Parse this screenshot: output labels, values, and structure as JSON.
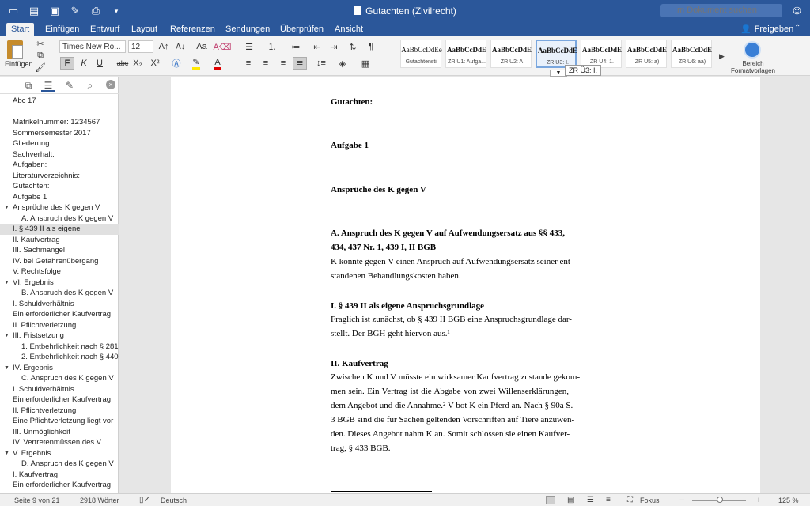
{
  "window": {
    "title": "Gutachten (Zivilrecht)",
    "search_placeholder": "Im Dokument suchen"
  },
  "tabs": [
    {
      "label": "Start"
    },
    {
      "label": "Einfügen"
    },
    {
      "label": "Entwurf"
    },
    {
      "label": "Layout"
    },
    {
      "label": "Referenzen"
    },
    {
      "label": "Sendungen"
    },
    {
      "label": "Überprüfen"
    },
    {
      "label": "Ansicht"
    }
  ],
  "share_label": "Freigeben",
  "ribbon": {
    "paste_label": "Einfügen",
    "font_name": "Times New Ro...",
    "font_size": "12",
    "bold": "F",
    "italic": "K",
    "underline": "U",
    "strike": "abc",
    "sub": "X₂",
    "sup": "X²",
    "styles_label": "Bereich Formatvorlagen",
    "tooltip": "ZR Ü3: I."
  },
  "styles": [
    {
      "sample": "AaBbCcDdEe",
      "name": "Gutachtenstil",
      "bold": false
    },
    {
      "sample": "AaBbCcDdE",
      "name": "ZR Ü1: Aufga...",
      "bold": true
    },
    {
      "sample": "AaBbCcDdE",
      "name": "ZR Ü2: A",
      "bold": true
    },
    {
      "sample": "AaBbCcDdE",
      "name": "ZR Ü3: I.",
      "bold": true
    },
    {
      "sample": "AaBbCcDdE",
      "name": "ZR Ü4: 1.",
      "bold": true
    },
    {
      "sample": "AaBbCcDdE",
      "name": "ZR Ü5: a)",
      "bold": true
    },
    {
      "sample": "AaBbCcDdE",
      "name": "ZR Ü6: aa)",
      "bold": true
    }
  ],
  "outline": [
    {
      "text": "Abc 17",
      "indent": 0
    },
    {
      "text": "",
      "indent": 0
    },
    {
      "text": "Matrikelnummer: 1234567",
      "indent": 0
    },
    {
      "text": "Sommersemester 2017",
      "indent": 0
    },
    {
      "text": "Gliederung:",
      "indent": 0
    },
    {
      "text": "Sachverhalt:",
      "indent": 0
    },
    {
      "text": "Aufgaben:",
      "indent": 0
    },
    {
      "text": "Literaturverzeichnis:",
      "indent": 0
    },
    {
      "text": "Gutachten:",
      "indent": 0
    },
    {
      "text": "Aufgabe 1",
      "indent": 0
    },
    {
      "text": "Ansprüche des K gegen V",
      "indent": 0,
      "tri": true
    },
    {
      "text": "A. Anspruch des K gegen V",
      "indent": 1
    },
    {
      "text": "I. § 439 II als eigene",
      "indent": 0,
      "selected": true
    },
    {
      "text": "II. Kaufvertrag",
      "indent": 0
    },
    {
      "text": "III. Sachmangel",
      "indent": 0
    },
    {
      "text": "IV. bei Gefahrenübergang",
      "indent": 0
    },
    {
      "text": "V. Rechtsfolge",
      "indent": 0
    },
    {
      "text": "VI. Ergebnis",
      "indent": 0,
      "tri": true
    },
    {
      "text": "B. Anspruch des K gegen V",
      "indent": 1
    },
    {
      "text": "I. Schuldverhältnis",
      "indent": 0
    },
    {
      "text": "Ein erforderlicher Kaufvertrag",
      "indent": 0
    },
    {
      "text": "II. Pflichtverletzung",
      "indent": 0
    },
    {
      "text": "III. Fristsetzung",
      "indent": 0,
      "tri": true
    },
    {
      "text": "1. Entbehrlichkeit nach § 281",
      "indent": 1
    },
    {
      "text": "2. Entbehrlichkeit nach § 440",
      "indent": 1
    },
    {
      "text": "IV. Ergebnis",
      "indent": 0,
      "tri": true
    },
    {
      "text": "C. Anspruch des K gegen V",
      "indent": 1
    },
    {
      "text": "I. Schuldverhältnis",
      "indent": 0
    },
    {
      "text": "Ein erforderlicher Kaufvertrag",
      "indent": 0
    },
    {
      "text": "II. Pflichtverletzung",
      "indent": 0
    },
    {
      "text": "Eine Pflichtverletzung liegt vor",
      "indent": 0
    },
    {
      "text": "III. Unmöglichkeit",
      "indent": 0
    },
    {
      "text": "IV. Vertretenmüssen des V",
      "indent": 0
    },
    {
      "text": "V. Ergebnis",
      "indent": 0,
      "tri": true
    },
    {
      "text": "D. Anspruch des K gegen V",
      "indent": 1
    },
    {
      "text": "I. Kaufvertrag",
      "indent": 0
    },
    {
      "text": "Ein erforderlicher Kaufvertrag",
      "indent": 0
    }
  ],
  "document": {
    "h_gutachten": "Gutachten:",
    "h_aufgabe": "Aufgabe 1",
    "h_ansprueche": "Ansprüche des K gegen V",
    "h_a_1": "A. Anspruch des K gegen V auf Aufwendungsersatz aus §§ 433,",
    "h_a_2": "434, 437 Nr. 1, 439 I, II BGB",
    "p1": [
      "K könnte gegen V einen Anspruch auf Aufwendungsersatz seiner ent-",
      "standenen Behandlungskosten haben."
    ],
    "h_i": "I. § 439 II als eigene Anspruchsgrundlage",
    "p2": [
      "Fraglich ist zunächst, ob § 439 II BGB eine Anspruchsgrundlage dar-",
      "stellt. Der BGH geht hiervon aus.¹"
    ],
    "h_ii": "II. Kaufvertrag",
    "p3": [
      "Zwischen K und V müsste ein wirksamer Kaufvertrag zustande gekom-",
      "men sein. Ein Vertrag ist die Abgabe von zwei Willenserklärungen,",
      "dem Angebot und die Annahme.² V bot K ein Pferd an. Nach § 90a S.",
      "3 BGB sind die für Sachen geltenden Vorschriften auf Tiere anzuwen-",
      "den. Dieses Angebot nahm K an. Somit schlossen sie einen Kaufver-",
      "trag, § 433 BGB."
    ]
  },
  "status": {
    "page": "Seite 9 von 21",
    "words": "2918 Wörter",
    "language": "Deutsch",
    "focus": "Fokus",
    "zoom": "125 %"
  }
}
